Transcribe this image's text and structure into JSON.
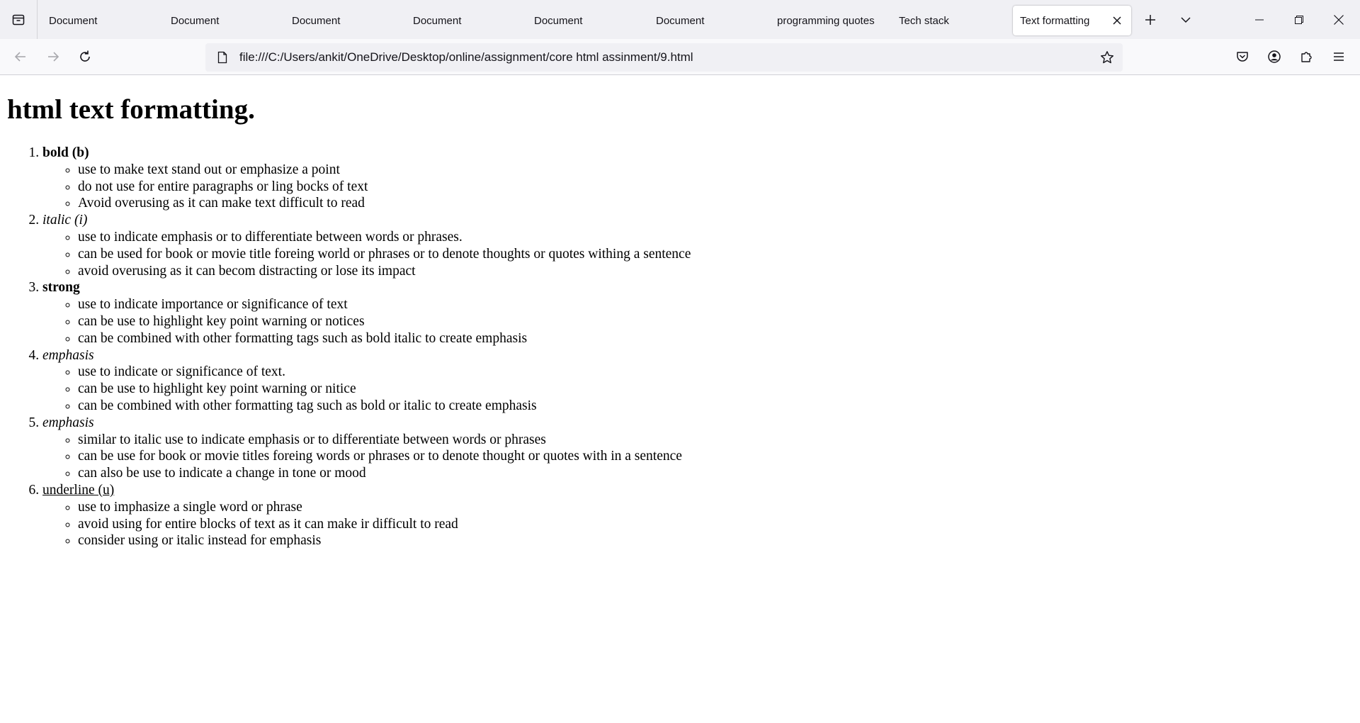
{
  "browser": {
    "tabs": [
      {
        "label": "Document"
      },
      {
        "label": "Document"
      },
      {
        "label": "Document"
      },
      {
        "label": "Document"
      },
      {
        "label": "Document"
      },
      {
        "label": "Document"
      },
      {
        "label": "programming quotes"
      },
      {
        "label": "Tech stack"
      },
      {
        "label": "Text formatting",
        "active": true
      }
    ],
    "url": "file:///C:/Users/ankit/OneDrive/Desktop/online/assignment/core html assinment/9.html"
  },
  "page": {
    "heading": "html text formatting.",
    "items": [
      {
        "title": "bold (b)",
        "style": "bold",
        "points": [
          "use to make text stand out or emphasize a point",
          "do not use for entire paragraphs or ling bocks of text",
          "Avoid overusing as it can make text difficult to read"
        ]
      },
      {
        "title": "italic (i)",
        "style": "italic",
        "points": [
          "use to indicate emphasis or to differentiate between words or phrases.",
          "can be used for book or movie title foreing world or phrases or to denote thoughts or quotes withing a sentence",
          "avoid overusing as it can becom distracting or lose its impact"
        ]
      },
      {
        "title": "strong",
        "style": "bold",
        "points": [
          "use to indicate importance or significance of text",
          "can be use to highlight key point warning or notices",
          "can be combined with other formatting tags such as bold italic to create emphasis"
        ]
      },
      {
        "title": "emphasis",
        "style": "italic",
        "points": [
          "use to indicate or significance of text.",
          "can be use to highlight key point warning or nitice",
          "can be combined with other formatting tag such as bold or italic to create emphasis"
        ]
      },
      {
        "title": "emphasis",
        "style": "italic",
        "points": [
          "similar to italic use to indicate emphasis or to differentiate between words or phrases",
          "can be use for book or movie titles foreing words or phrases or to denote thought or quotes with in a sentence",
          "can also be use to indicate a change in tone or mood"
        ]
      },
      {
        "title": "underline (u)",
        "style": "underline",
        "points": [
          "use to imphasize a single word or phrase",
          "avoid using for entire blocks of text as it can make ir difficult to read",
          "consider using or italic instead for emphasis"
        ]
      }
    ]
  }
}
